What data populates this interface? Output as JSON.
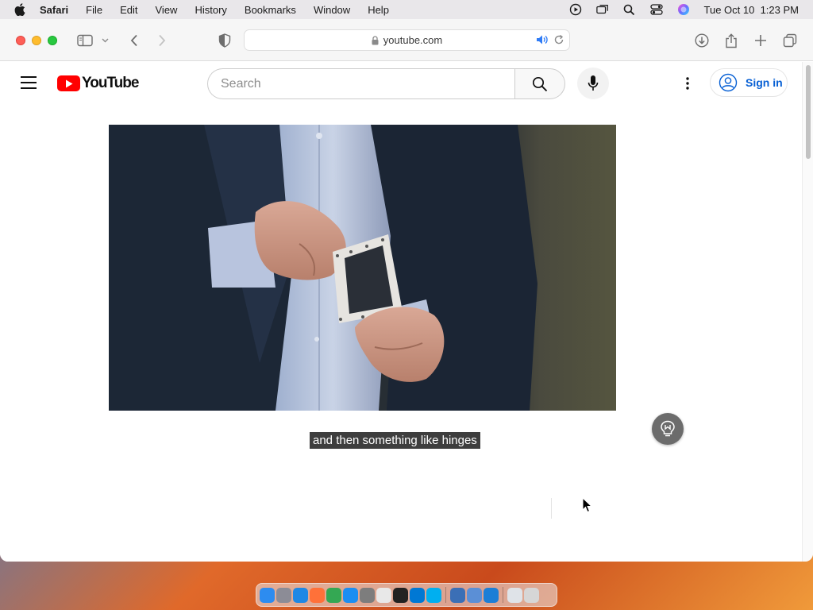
{
  "menubar": {
    "app_name": "Safari",
    "items": [
      "File",
      "Edit",
      "View",
      "History",
      "Bookmarks",
      "Window",
      "Help"
    ],
    "clock": "Tue Oct 10  1:23 PM"
  },
  "browser": {
    "url": "youtube.com"
  },
  "youtube": {
    "logo_text": "YouTube",
    "search_placeholder": "Search",
    "sign_in_label": "Sign in",
    "caption": "and then something like hinges"
  },
  "colors": {
    "youtube_red": "#ff0000",
    "link_blue": "#065fd4"
  },
  "dock": {
    "apps": [
      {
        "icon": "finder-icon",
        "color": "#2d8cf0"
      },
      {
        "icon": "launchpad-icon",
        "color": "#8c8c96"
      },
      {
        "icon": "safari-icon",
        "color": "#1e88e5"
      },
      {
        "icon": "firefox-icon",
        "color": "#ff7139"
      },
      {
        "icon": "chrome-icon",
        "color": "#34a853"
      },
      {
        "icon": "app-store-icon",
        "color": "#1b8ef2"
      },
      {
        "icon": "system-settings-icon",
        "color": "#7d7d7d"
      },
      {
        "icon": "textedit-icon",
        "color": "#e8e8e8"
      },
      {
        "icon": "terminal-icon",
        "color": "#222222"
      },
      {
        "icon": "vscode-icon",
        "color": "#0078d4"
      },
      {
        "icon": "skype-icon",
        "color": "#00aff0"
      },
      {
        "icon": "migration-assistant-icon",
        "color": "#3b6fb6"
      },
      {
        "icon": "screen-sharing-icon",
        "color": "#5b8fd6"
      },
      {
        "icon": "xcode-icon",
        "color": "#1c7ed6"
      },
      {
        "icon": "downloads-folder-icon",
        "color": "#dfe3e8"
      },
      {
        "icon": "trash-icon",
        "color": "#d6d6d6"
      }
    ]
  }
}
